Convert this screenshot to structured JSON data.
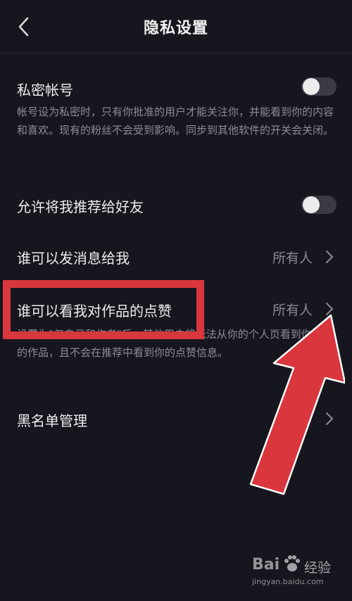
{
  "header": {
    "title": "隐私设置"
  },
  "settings": {
    "private_account": {
      "label": "私密帐号",
      "enabled": false,
      "description": "帐号设为私密时，只有你批准的用户才能关注你，并能看到你的内容和喜欢。现有的粉丝不会受到影响。同步到其他软件的开关会关闭。"
    },
    "recommend_to_friends": {
      "label": "允许将我推荐给好友",
      "enabled": false
    },
    "who_can_message": {
      "label": "谁可以发消息给我",
      "value": "所有人"
    },
    "who_can_see_likes": {
      "label": "谁可以看我对作品的点赞",
      "value": "所有人",
      "description": "设置为\"仅自己和作者\"后，其他用户将无法从你的个人页看到你赞过的作品，且不会在推荐中看到你的点赞信息。"
    },
    "blacklist": {
      "label": "黑名单管理"
    }
  },
  "watermark": {
    "logo": "Bai",
    "brand": "经验",
    "url": "jingyan.baidu.com"
  },
  "colors": {
    "background": "#16161e",
    "annotation_red": "#d9363e",
    "toggle_off": "#3b3b45"
  }
}
